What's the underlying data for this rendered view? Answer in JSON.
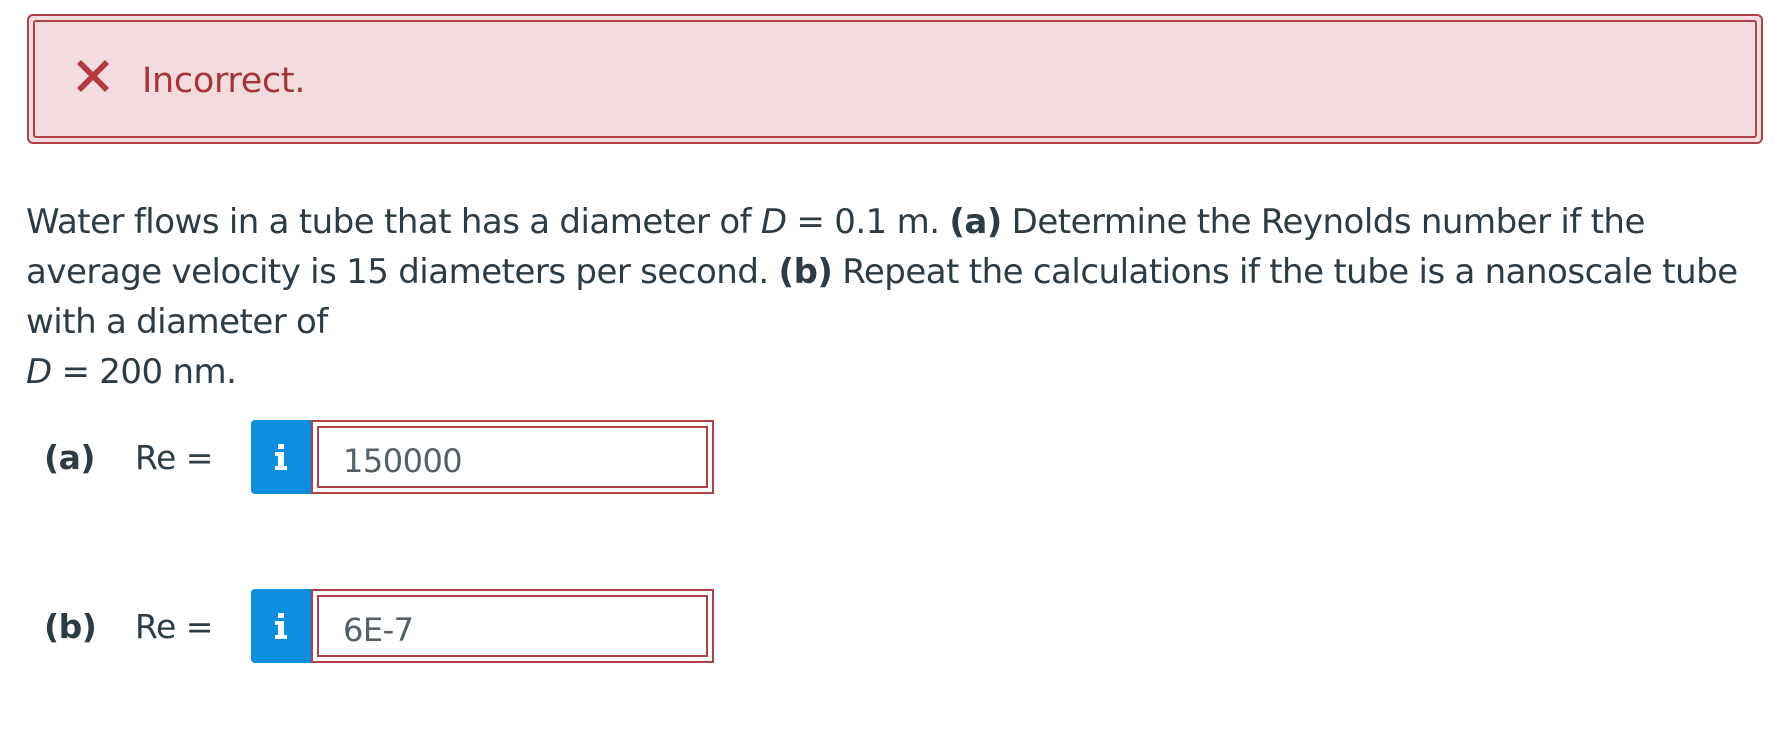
{
  "alert": {
    "icon": "close-icon",
    "text": "Incorrect.",
    "color": "#a5343b",
    "background": "#f3dcde"
  },
  "question": {
    "p1": "Water flows in a tube that has a diameter of ",
    "d1_var": "D",
    "d1_value": " = 0.1 m. ",
    "a_label": "(a)",
    "p2": " Determine the Reynolds number if the average velocity is 15 diameters per second. ",
    "b_label": "(b)",
    "p3": " Repeat the calculations if the tube is a nanoscale tube with a diameter of ",
    "d2_var": "D",
    "d2_value": " = 200 nm."
  },
  "answers": [
    {
      "label": "(a)",
      "equation": "Re =",
      "info_icon": "info-icon",
      "value": "150000"
    },
    {
      "label": "(b)",
      "equation": "Re =",
      "info_icon": "info-icon",
      "value": "6E-7"
    }
  ],
  "colors": {
    "info_button": "#0b8ee0",
    "error_border": "#b04148",
    "text": "#2d3b45"
  }
}
